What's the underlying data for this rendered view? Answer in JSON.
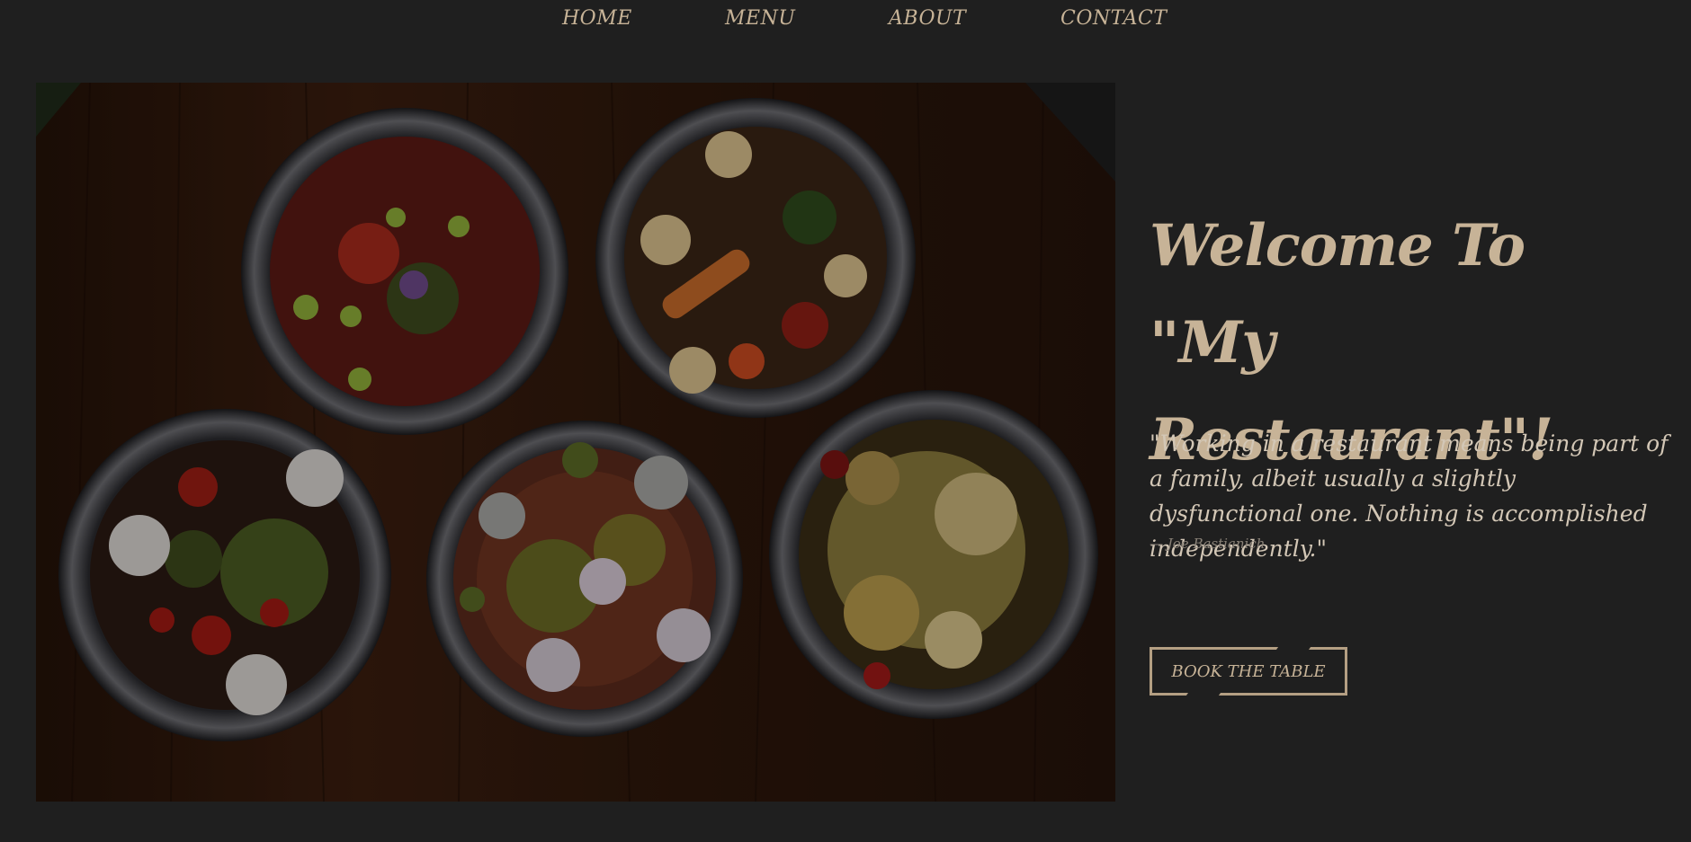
{
  "nav": {
    "items": [
      {
        "label": "HOME"
      },
      {
        "label": "MENU"
      },
      {
        "label": "ABOUT"
      },
      {
        "label": "CONTACT"
      }
    ]
  },
  "hero": {
    "image_alt_name": "food-bowls-image"
  },
  "welcome": {
    "line1": "Welcome To",
    "line2": "\"My Restaurant\"!"
  },
  "quote": {
    "text": "\"Working in a restaurant means being part of a family, albeit usually a slightly dysfunctional one. Nothing is accomplished independently.\"",
    "author": "— Joe Bastianich"
  },
  "cta": {
    "label": "BOOK THE TABLE"
  },
  "colors": {
    "background": "#1f1f1f",
    "accent": "#c7b397",
    "quote_text": "#d3c7b6"
  }
}
